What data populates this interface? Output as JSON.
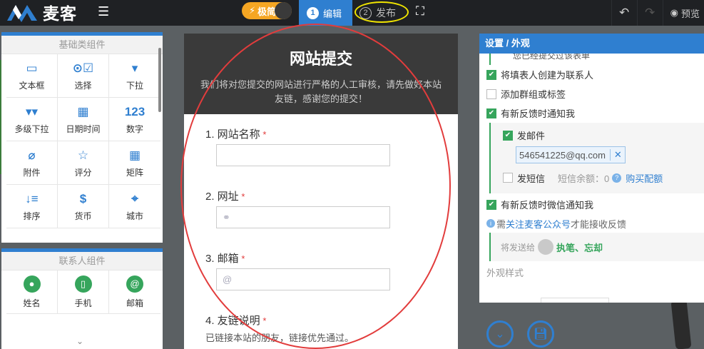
{
  "app": {
    "name": "麦客"
  },
  "topbar": {
    "mode_label": "极简",
    "steps": [
      {
        "num": "1",
        "label": "编辑"
      },
      {
        "num": "2",
        "label": "发布"
      }
    ],
    "preview_label": "预览"
  },
  "left": {
    "basic": {
      "title": "基础类组件",
      "items": [
        {
          "icon": "text-box-icon",
          "glyph": "▭",
          "label": "文本框"
        },
        {
          "icon": "choice-icon",
          "glyph": "⊙☑",
          "label": "选择"
        },
        {
          "icon": "dropdown-icon",
          "glyph": "▾",
          "label": "下拉"
        },
        {
          "icon": "multi-dropdown-icon",
          "glyph": "▾▾",
          "label": "多级下拉"
        },
        {
          "icon": "calendar-icon",
          "glyph": "▦",
          "label": "日期时间"
        },
        {
          "icon": "number-icon",
          "glyph": "123",
          "label": "数字"
        },
        {
          "icon": "paperclip-icon",
          "glyph": "⌀",
          "label": "附件"
        },
        {
          "icon": "star-icon",
          "glyph": "☆",
          "label": "评分"
        },
        {
          "icon": "matrix-icon",
          "glyph": "▦",
          "label": "矩阵"
        },
        {
          "icon": "sort-icon",
          "glyph": "↓≡",
          "label": "排序"
        },
        {
          "icon": "currency-icon",
          "glyph": "$",
          "label": "货币"
        },
        {
          "icon": "location-icon",
          "glyph": "⌖",
          "label": "城市"
        }
      ]
    },
    "contact": {
      "title": "联系人组件",
      "items": [
        {
          "icon": "person-icon",
          "glyph": "●",
          "label": "姓名"
        },
        {
          "icon": "phone-icon",
          "glyph": "▯",
          "label": "手机"
        },
        {
          "icon": "at-icon",
          "glyph": "@",
          "label": "邮箱"
        }
      ]
    }
  },
  "form": {
    "title": "网站提交",
    "description": "我们将对您提交的网站进行严格的人工审核，请先做好本站友链，感谢您的提交！",
    "questions": [
      {
        "label": "1. 网站名称",
        "required": "*",
        "prefix": ""
      },
      {
        "label": "2. 网址",
        "required": "*",
        "prefix": "⚭"
      },
      {
        "label": "3. 邮箱",
        "required": "*",
        "prefix": "@"
      },
      {
        "label": "4. 友链说明",
        "required": "*",
        "note": "已链接本站的朋友，链接优先通过。"
      }
    ]
  },
  "settings": {
    "title": "设置 / 外观",
    "clipped_text": "您已经提交过该表单",
    "options": [
      {
        "label": "将填表人创建为联系人",
        "checked": true
      },
      {
        "label": "添加群组或标签",
        "checked": false
      },
      {
        "label": "有新反馈时通知我",
        "checked": true
      }
    ],
    "email_option": {
      "label": "发邮件",
      "checked": true
    },
    "email_tag": "546541225@qq.com",
    "sms_option": {
      "label": "发短信",
      "checked": false
    },
    "sms_balance": "短信余额：0",
    "buy_link": "购买配额",
    "wechat_option": {
      "label": "有新反馈时微信通知我",
      "checked": true
    },
    "wechat_info_prefix": "需",
    "wechat_info_link": "关注麦客公众号",
    "wechat_info_suffix": "才能接收反馈",
    "send_to_label": "将发送给",
    "recipients": "执笔、忘却",
    "appearance_label": "外观样式"
  },
  "colors": {
    "accent": "#2f7fd0",
    "green": "#36a55c",
    "dark": "#1f2124",
    "required": "#e23c3c"
  }
}
